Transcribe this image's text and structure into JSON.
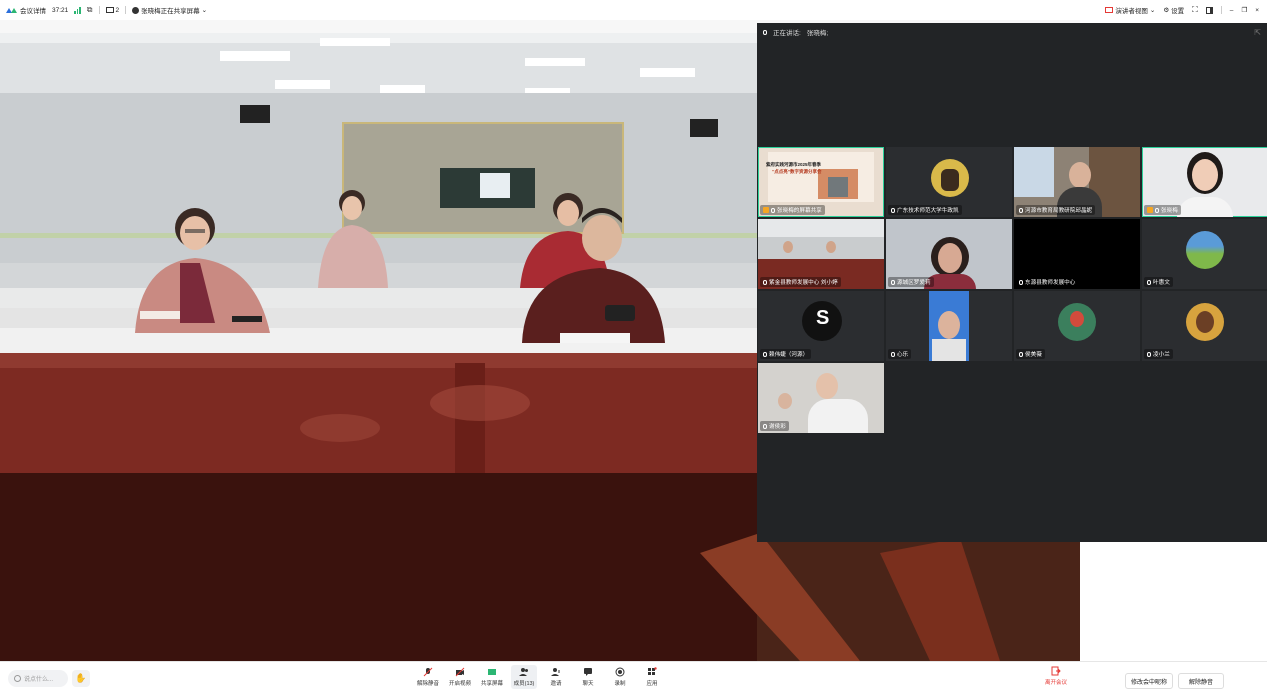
{
  "topbar": {
    "meeting_info": "会议详情",
    "duration": "37:21",
    "participants": "2",
    "sharing_status": "张晓梅正在共享屏幕",
    "view_label": "演讲者视图",
    "settings_label": "设置"
  },
  "panel": {
    "speaking_label": "正在讲话:",
    "speaker_name": "张晓梅;"
  },
  "tiles": [
    {
      "name": "张晓梅的屏幕共享",
      "host": true,
      "mic": true,
      "active": true
    },
    {
      "name": "广东技术师范大学牛政凯",
      "host": false,
      "mic": true,
      "active": false
    },
    {
      "name": "河源市教育局教研院邱晶妮",
      "host": false,
      "mic": true,
      "active": false
    },
    {
      "name": "张晓梅",
      "host": true,
      "mic": true,
      "active": true
    },
    {
      "name": "紫金县教师发展中心 刘小婷",
      "host": false,
      "mic": true,
      "active": false
    },
    {
      "name": "源城区罗爱莉",
      "host": false,
      "mic": true,
      "active": false
    },
    {
      "name": "东源县教师发展中心",
      "host": false,
      "mic": true,
      "active": false
    },
    {
      "name": "叶惠文",
      "host": false,
      "mic": true,
      "active": false
    },
    {
      "name": "赖伟婕（河源）",
      "host": false,
      "mic": true,
      "active": false
    },
    {
      "name": "心乐",
      "host": false,
      "mic": true,
      "active": false
    },
    {
      "name": "侯美薇",
      "host": false,
      "mic": true,
      "active": false
    },
    {
      "name": "凌小兰",
      "host": false,
      "mic": true,
      "active": false
    },
    {
      "name": "谢侯彩",
      "host": false,
      "mic": true,
      "active": false
    }
  ],
  "slide": {
    "title_line1": "紫府实践河源市2025年春季",
    "title_line2": "“点点亮”数字资源分享会"
  },
  "bottombar": {
    "chat_placeholder": "说点什么...",
    "tools": [
      {
        "label": "解除静音",
        "icon": "mic-off-icon"
      },
      {
        "label": "开启视频",
        "icon": "camera-off-icon"
      },
      {
        "label": "共享屏幕",
        "icon": "share-screen-icon"
      },
      {
        "label": "成员(13)",
        "icon": "members-icon"
      },
      {
        "label": "邀请",
        "icon": "invite-icon"
      },
      {
        "label": "聊天",
        "icon": "chat-icon"
      },
      {
        "label": "录制",
        "icon": "record-icon"
      },
      {
        "label": "应用",
        "icon": "apps-icon"
      }
    ],
    "leave_label": "离开会议",
    "rename_label": "修改会中昵称",
    "unmute_label": "解除静音"
  }
}
